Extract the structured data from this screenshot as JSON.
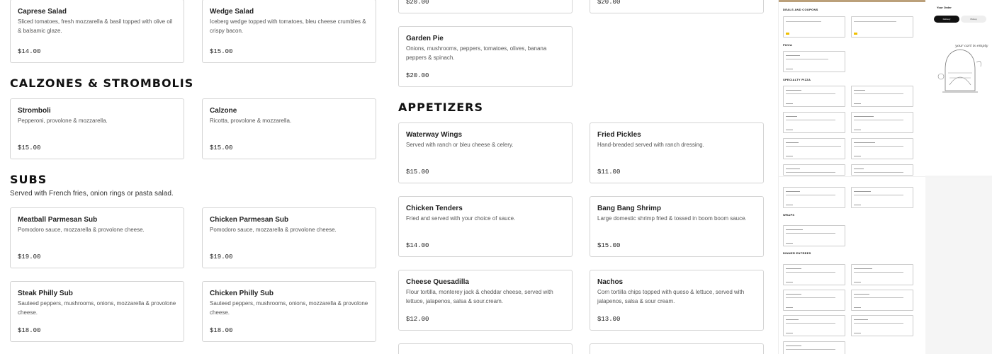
{
  "left_column": {
    "top_cards": [
      {
        "name": "Caprese Salad",
        "desc": "Sliced tomatoes, fresh mozzarella & basil topped with olive oil & balsamic glaze.",
        "price": "$14.00"
      },
      {
        "name": "Wedge Salad",
        "desc": "Iceberg wedge topped with tomatoes, bleu cheese crumbles & crispy bacon.",
        "price": "$15.00"
      }
    ],
    "calzones": {
      "title": "CALZONES & STROMBOLIS",
      "items": [
        {
          "name": "Stromboli",
          "desc": "Pepperoni, provolone & mozzarella.",
          "price": "$15.00"
        },
        {
          "name": "Calzone",
          "desc": "Ricotta, provolone & mozzarella.",
          "price": "$15.00"
        }
      ]
    },
    "subs": {
      "title": "SUBS",
      "subtitle": "Served with French fries, onion rings or pasta salad.",
      "items": [
        {
          "name": "Meatball Parmesan Sub",
          "desc": "Pomodoro sauce, mozzarella & provolone cheese.",
          "price": "$19.00"
        },
        {
          "name": "Chicken Parmesan Sub",
          "desc": "Pomodoro sauce, mozzarella & provolone cheese.",
          "price": "$19.00"
        },
        {
          "name": "Steak Philly Sub",
          "desc": "Sauteed peppers, mushrooms, onions, mozzarella & provolone cheese.",
          "price": "$18.00"
        },
        {
          "name": "Chicken Philly Sub",
          "desc": "Sauteed peppers, mushrooms, onions, mozzarella & provolone cheese.",
          "price": "$18.00"
        }
      ]
    }
  },
  "middle_column": {
    "top_prices": [
      "$20.00",
      "$20.00"
    ],
    "garden_pie": {
      "name": "Garden Pie",
      "desc": "Onions, mushrooms, peppers, tomatoes, olives, banana peppers & spinach.",
      "price": "$20.00"
    },
    "appetizers": {
      "title": "APPETIZERS",
      "items": [
        {
          "name": "Waterway Wings",
          "desc": "Served with ranch or bleu cheese & celery.",
          "price": "$15.00"
        },
        {
          "name": "Fried Pickles",
          "desc": "Hand-breaded served with ranch dressing.",
          "price": "$11.00"
        },
        {
          "name": "Chicken Tenders",
          "desc": "Fried and served with your choice of sauce.",
          "price": "$14.00"
        },
        {
          "name": "Bang Bang Shrimp",
          "desc": "Large domestic shrimp fried & tossed in boom boom sauce.",
          "price": "$15.00"
        },
        {
          "name": "Cheese Quesadilla",
          "desc": "Flour tortilla, monterey jack & cheddar cheese, served with lettuce, jalapenos, salsa & sour.cream.",
          "price": "$12.00"
        },
        {
          "name": "Nachos",
          "desc": "Corn tortilla chips topped with queso & lettuce, served with jalapenos, salsa & sour cream.",
          "price": "$13.00"
        }
      ]
    }
  },
  "preview": {
    "sections": [
      "DEALS AND COUPONS",
      "PIZZA",
      "SPECIALTY PIZZA",
      "WRAPS",
      "DINNER ENTREES"
    ]
  },
  "order_panel": {
    "title": "Your Order",
    "delivery": "Delivery",
    "pickup": "Pickup",
    "cart_text": "your cart is empty"
  }
}
